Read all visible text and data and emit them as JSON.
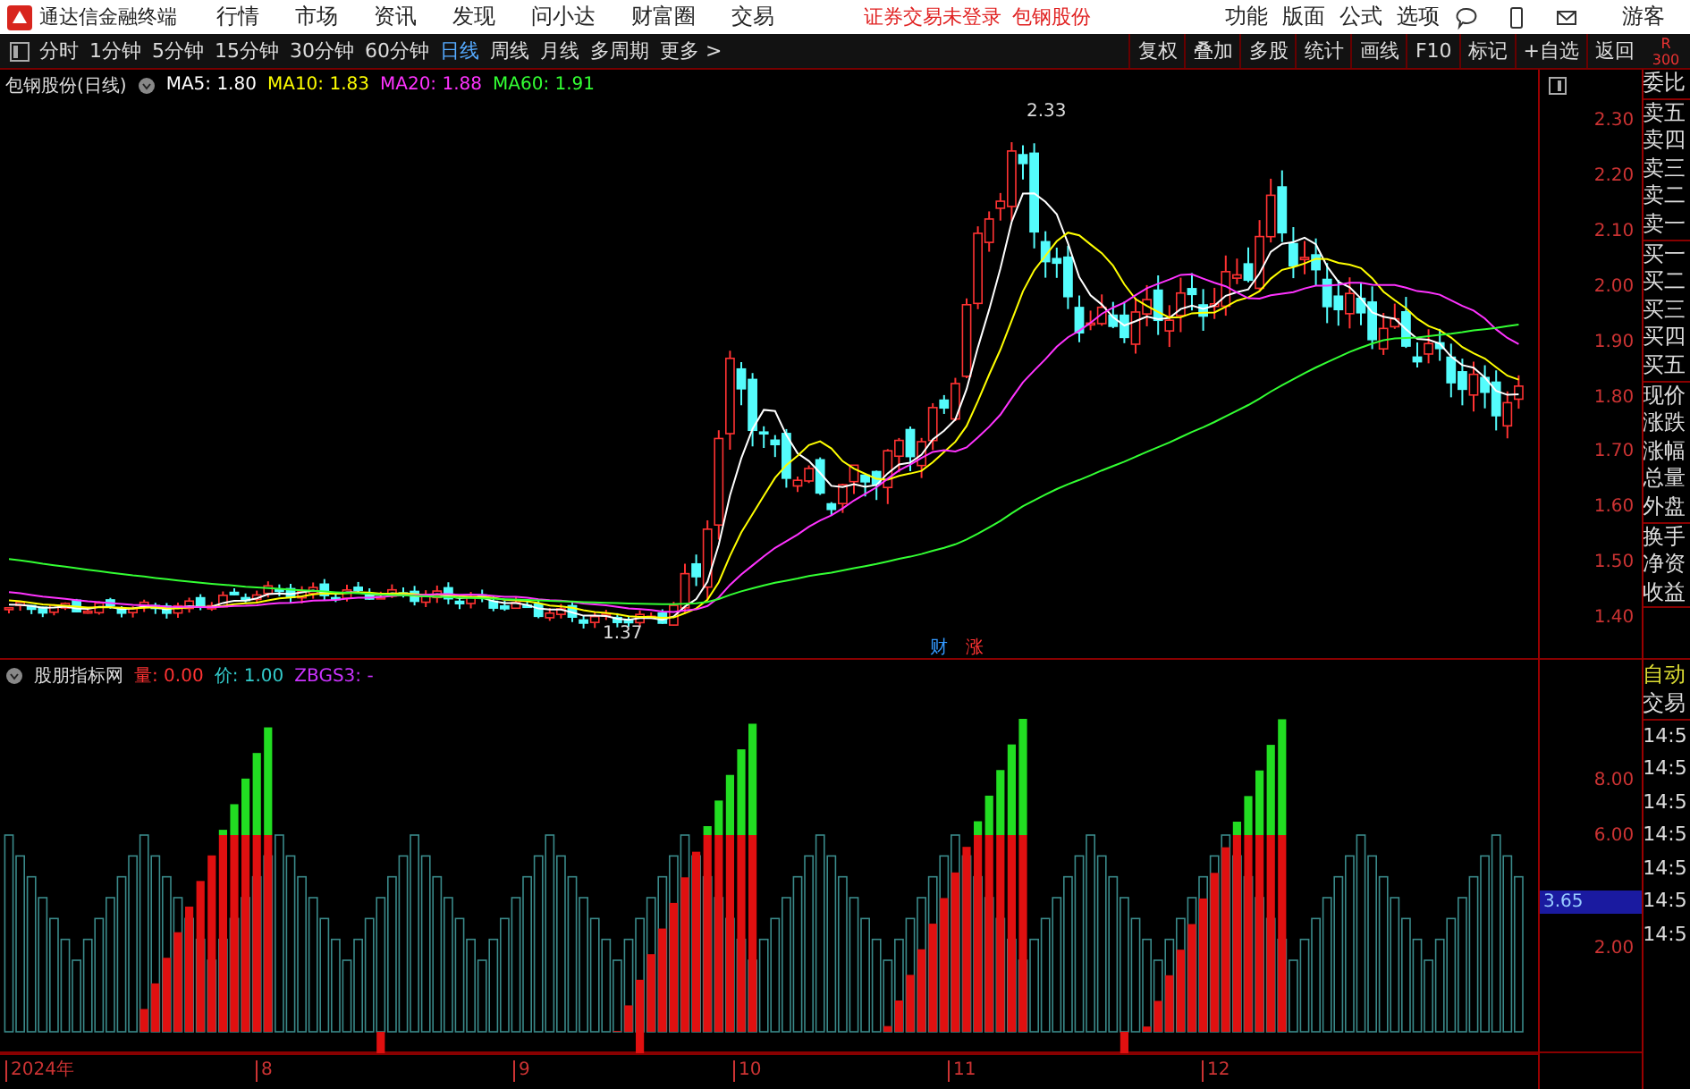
{
  "menubar": {
    "app_title": "通达信金融终端",
    "items": [
      "行情",
      "市场",
      "资讯",
      "发现",
      "问小达",
      "财富圈",
      "交易"
    ],
    "notice": "证券交易未登录",
    "stock_link": "包钢股份",
    "right_items": [
      "功能",
      "版面",
      "公式",
      "选项"
    ],
    "user": "游客"
  },
  "toolbar": {
    "periods": [
      {
        "label": "分时",
        "selected": false
      },
      {
        "label": "1分钟",
        "selected": false
      },
      {
        "label": "5分钟",
        "selected": false
      },
      {
        "label": "15分钟",
        "selected": false
      },
      {
        "label": "30分钟",
        "selected": false
      },
      {
        "label": "60分钟",
        "selected": false
      },
      {
        "label": "日线",
        "selected": true
      },
      {
        "label": "周线",
        "selected": false
      },
      {
        "label": "月线",
        "selected": false
      },
      {
        "label": "多周期",
        "selected": false
      },
      {
        "label": "更多 >",
        "selected": false
      }
    ],
    "buttons": [
      "复权",
      "叠加",
      "多股",
      "统计",
      "画线",
      "F10",
      "标记",
      "+自选",
      "返回"
    ],
    "corner": [
      "R",
      "300"
    ]
  },
  "main_chart": {
    "title": "包钢股份(日线)",
    "legend": [
      {
        "label": "MA5: 1.80",
        "color": "#ffffff"
      },
      {
        "label": "MA10: 1.83",
        "color": "#ffff00"
      },
      {
        "label": "MA20: 1.88",
        "color": "#ff33ff"
      },
      {
        "label": "MA60: 1.91",
        "color": "#33ff33"
      }
    ],
    "high_label": "2.33",
    "low_label": "1.37",
    "markers": [
      {
        "text": "财",
        "color": "#3399ff"
      },
      {
        "text": "涨",
        "color": "#ff3333"
      }
    ],
    "price_ticks": [
      "2.30",
      "2.20",
      "2.10",
      "2.00",
      "1.90",
      "1.80",
      "1.70",
      "1.60",
      "1.50",
      "1.40"
    ]
  },
  "indicator": {
    "title": "股朋指标网",
    "legend": [
      {
        "label": "量: 0.00",
        "color": "#ff3333"
      },
      {
        "label": "价: 1.00",
        "color": "#33cccc"
      },
      {
        "label": "ZBGS3: -",
        "color": "#cc33ff"
      }
    ],
    "ticks": [
      "8.00",
      "6.00",
      "2.00"
    ],
    "current": "3.65"
  },
  "x_axis": [
    "2024年",
    "8",
    "9",
    "10",
    "11",
    "12"
  ],
  "quote_panel": {
    "groups": [
      [
        "委比"
      ],
      [
        "卖五",
        "卖四",
        "卖三",
        "卖二",
        "卖一"
      ],
      [
        "买一",
        "买二",
        "买三",
        "买四",
        "买五"
      ],
      [
        "现价",
        "涨跌",
        "涨幅",
        "总量",
        "外盘"
      ],
      [
        "换手",
        "净资",
        "收益"
      ]
    ]
  },
  "trade_panel": {
    "mode": "自动",
    "title": "交易",
    "times": [
      "14:5",
      "14:5",
      "14:5",
      "14:5",
      "14:5",
      "14:5",
      "14:5"
    ]
  }
}
